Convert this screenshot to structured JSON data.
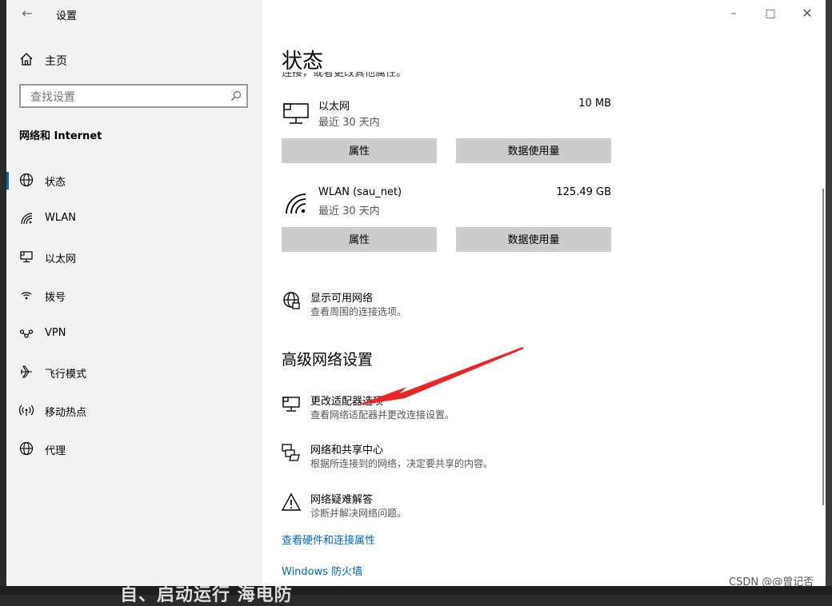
{
  "window": {
    "title": "设置"
  },
  "sidebar": {
    "home_label": "主页",
    "search_placeholder": "查找设置",
    "section_title": "网络和 Internet",
    "items": [
      {
        "label": "状态",
        "icon": "globe-icon",
        "active": true
      },
      {
        "label": "WLAN",
        "icon": "wifi-icon",
        "active": false
      },
      {
        "label": "以太网",
        "icon": "ethernet-icon",
        "active": false
      },
      {
        "label": "拨号",
        "icon": "dialup-icon",
        "active": false
      },
      {
        "label": "VPN",
        "icon": "vpn-icon",
        "active": false
      },
      {
        "label": "飞行模式",
        "icon": "airplane-icon",
        "active": false
      },
      {
        "label": "移动热点",
        "icon": "hotspot-icon",
        "active": false
      },
      {
        "label": "代理",
        "icon": "globe-icon",
        "active": false
      }
    ]
  },
  "main": {
    "title": "状态",
    "cut_text": "连接，或者更改其他属性。",
    "networks": [
      {
        "name": "以太网",
        "sub": "最近 30 天内",
        "size": "10 MB",
        "icon": "ethernet-icon",
        "btn_properties": "属性",
        "btn_usage": "数据使用量"
      },
      {
        "name": "WLAN (sau_net)",
        "sub": "最近 30 天内",
        "size": "125.49 GB",
        "icon": "wifi-icon",
        "btn_properties": "属性",
        "btn_usage": "数据使用量"
      }
    ],
    "show_networks": {
      "title": "显示可用网络",
      "desc": "查看周围的连接选项。"
    },
    "advanced_heading": "高级网络设置",
    "options": [
      {
        "title": "更改适配器选项",
        "desc": "查看网络适配器并更改连接设置。"
      },
      {
        "title": "网络和共享中心",
        "desc": "根据所连接到的网络，决定要共享的内容。"
      },
      {
        "title": "网络疑难解答",
        "desc": "诊断并解决网络问题。"
      }
    ],
    "links": {
      "hardware": "查看硬件和连接属性",
      "firewall": "Windows 防火墙"
    }
  },
  "background": {
    "bottom_text": "自、启动运行 海电防"
  },
  "watermark": "CSDN @@曾记否",
  "colors": {
    "accent": "#0067c0",
    "arrow": "#e8262a"
  }
}
